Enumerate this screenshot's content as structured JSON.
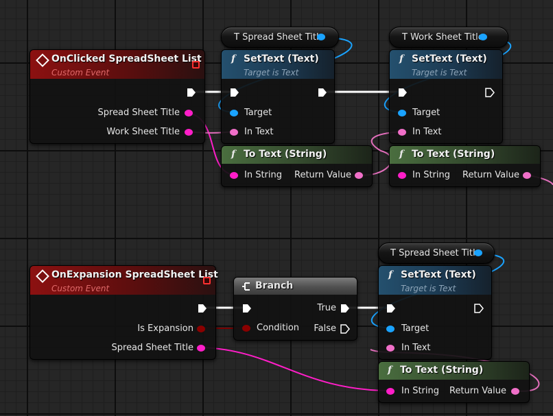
{
  "graph": {
    "onclicked_event": {
      "title": "OnClicked SpreadSheet List",
      "subtitle": "Custom Event",
      "pins": [
        "Spread Sheet Title",
        "Work Sheet Title"
      ]
    },
    "settext_1": {
      "title": "SetText (Text)",
      "subtitle": "Target is Text",
      "target_label": "Target",
      "intext_label": "In Text"
    },
    "settext_2": {
      "title": "SetText (Text)",
      "subtitle": "Target is Text",
      "target_label": "Target",
      "intext_label": "In Text"
    },
    "var_spread_1": {
      "label": "T Spread Sheet Title"
    },
    "var_work_1": {
      "label": "T Work Sheet Title"
    },
    "totext_1": {
      "title": "To Text (String)",
      "in_label": "In String",
      "out_label": "Return Value"
    },
    "totext_2": {
      "title": "To Text (String)",
      "in_label": "In String",
      "out_label": "Return Value"
    },
    "onexpansion_event": {
      "title": "OnExpansion SpreadSheet List",
      "subtitle": "Custom Event",
      "pins": [
        "Is Expansion",
        "Spread Sheet Title"
      ]
    },
    "branch": {
      "title": "Branch",
      "condition_label": "Condition",
      "true_label": "True",
      "false_label": "False"
    },
    "settext_3": {
      "title": "SetText (Text)",
      "subtitle": "Target is Text",
      "target_label": "Target",
      "intext_label": "In Text"
    },
    "var_spread_2": {
      "label": "T Spread Sheet Title"
    },
    "totext_3": {
      "title": "To Text (String)",
      "in_label": "In String",
      "out_label": "Return Value"
    },
    "function_glyph": "f",
    "icons": [
      "event-diamond-icon",
      "stop-square-icon",
      "exec-pin-icon",
      "data-pin-icon",
      "branch-icon"
    ],
    "colors": {
      "event_header": "#8c1111",
      "function_header": "#24506e",
      "pure_header": "#4a6e3f",
      "branch_header": "#6a6a6a",
      "exec_wire": "#ffffff",
      "string_pin": "#ff1ec8",
      "text_pin": "#f06fc8",
      "object_pin": "#1aa3ff",
      "bool_pin": "#8a0000"
    }
  }
}
